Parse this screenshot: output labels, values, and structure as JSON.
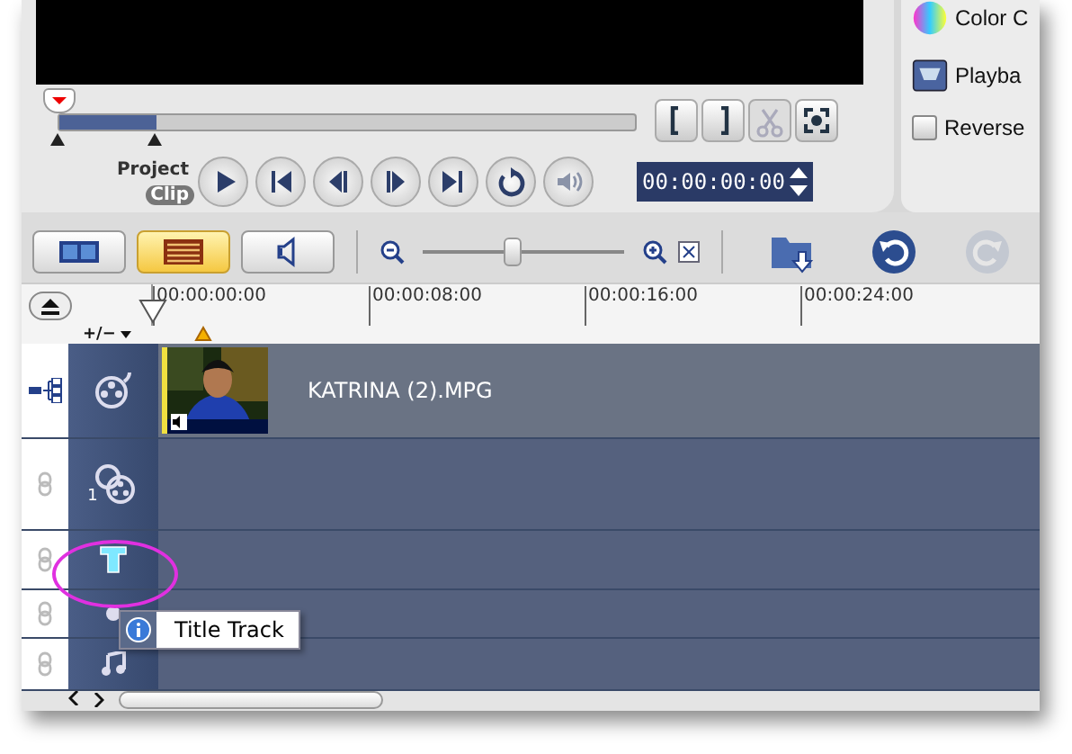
{
  "player": {
    "scrub": {
      "level": 0.17
    },
    "modes": [
      {
        "label": "Project",
        "selected": false
      },
      {
        "label": "Clip",
        "selected": true
      }
    ],
    "edit_buttons": [
      {
        "kind": "mark-in",
        "disabled": false
      },
      {
        "kind": "mark-out",
        "disabled": false
      },
      {
        "kind": "cut",
        "disabled": true
      },
      {
        "kind": "snapshot",
        "disabled": false
      }
    ],
    "transport": [
      {
        "kind": "play"
      },
      {
        "kind": "home"
      },
      {
        "kind": "prev"
      },
      {
        "kind": "next"
      },
      {
        "kind": "end"
      },
      {
        "kind": "repeat"
      },
      {
        "kind": "volume"
      }
    ],
    "timecode": "00:00:00:00"
  },
  "options": {
    "color_label": "Color C",
    "playback_label": "Playba",
    "reverse": {
      "label": "Reverse",
      "checked": false
    }
  },
  "toolbar": {
    "views": [
      {
        "kind": "storyboard",
        "selected": false
      },
      {
        "kind": "timeline",
        "selected": true
      },
      {
        "kind": "audio",
        "selected": false
      }
    ],
    "zoom": {
      "level": 0.45
    },
    "undo_disabled": false,
    "redo_disabled": true
  },
  "ruler": {
    "add_remove": "+/−",
    "ticks": [
      "00:00:00:00",
      "00:00:08:00",
      "00:00:16:00",
      "00:00:24:00"
    ]
  },
  "tracks": [
    {
      "kind": "video",
      "clip": {
        "name": "KATRINA (2).MPG"
      }
    },
    {
      "kind": "overlay",
      "number": "1"
    },
    {
      "kind": "title",
      "highlighted": true
    },
    {
      "kind": "voice"
    },
    {
      "kind": "music"
    }
  ],
  "tooltip": "Title Track"
}
